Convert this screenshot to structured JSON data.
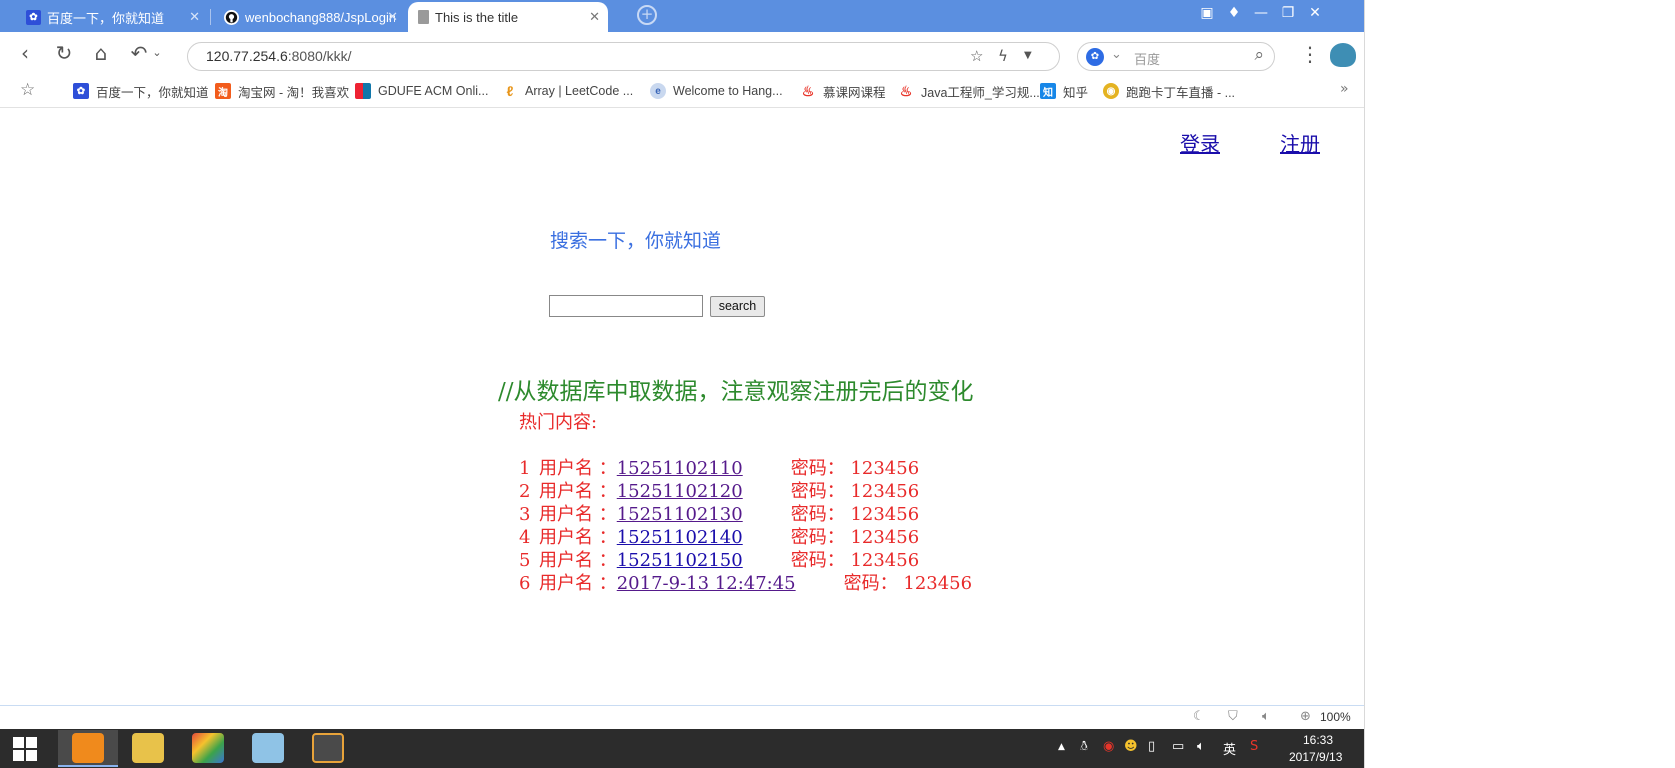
{
  "tabs": [
    {
      "title": "百度一下，你就知道",
      "active": false
    },
    {
      "title": "wenbochang888/JspLogin",
      "active": false
    },
    {
      "title": "This is the title",
      "active": true
    }
  ],
  "address": {
    "host": "120.77.254.6",
    "path": ":8080/kkk/"
  },
  "search_engine": {
    "placeholder": "百度"
  },
  "bookmarks": [
    "百度一下，你就知道",
    "淘宝网 - 淘！我喜欢",
    "GDUFE ACM Onli...",
    "Array | LeetCode ...",
    "Welcome to Hang...",
    "慕课网课程",
    "Java工程师_学习规...",
    "知乎",
    "跑跑卡丁车直播 - ..."
  ],
  "page": {
    "login_label": "登录",
    "register_label": "注册",
    "slogan": "搜索一下，你就知道",
    "search_input_value": "",
    "search_button_label": "search",
    "db_comment": "//从数据库中取数据，注意观察注册完后的变化",
    "hot_title": "热门内容:",
    "user_label": "用户名 ：",
    "users": [
      {
        "index": "1",
        "name": "15251102110",
        "pw_label": "密码：",
        "password": "123456",
        "visited": true
      },
      {
        "index": "2",
        "name": "15251102120",
        "pw_label": "密码：",
        "password": "123456",
        "visited": true
      },
      {
        "index": "3",
        "name": "15251102130",
        "pw_label": "密码：",
        "password": "123456",
        "visited": true
      },
      {
        "index": "4",
        "name": "15251102140",
        "pw_label": "密码：",
        "password": "123456",
        "visited": false
      },
      {
        "index": "5",
        "name": "15251102150",
        "pw_label": "密码：",
        "password": "123456",
        "visited": false
      },
      {
        "index": "6",
        "name": "2017-9-13 12:47:45",
        "pw_label": "密码：",
        "password": "123456",
        "visited": true
      }
    ]
  },
  "statusbar": {
    "zoom": "100%"
  },
  "taskbar": {
    "time": "16:33",
    "date": "2017/9/13",
    "ime": "英"
  },
  "colors": {
    "tabbar": "#5b8fe0",
    "link": "#1a0dab",
    "slogan": "#3a6fe0",
    "comment": "#2d8a2d",
    "content": "#e82a2a",
    "taskbar": "#2c2c2c"
  }
}
